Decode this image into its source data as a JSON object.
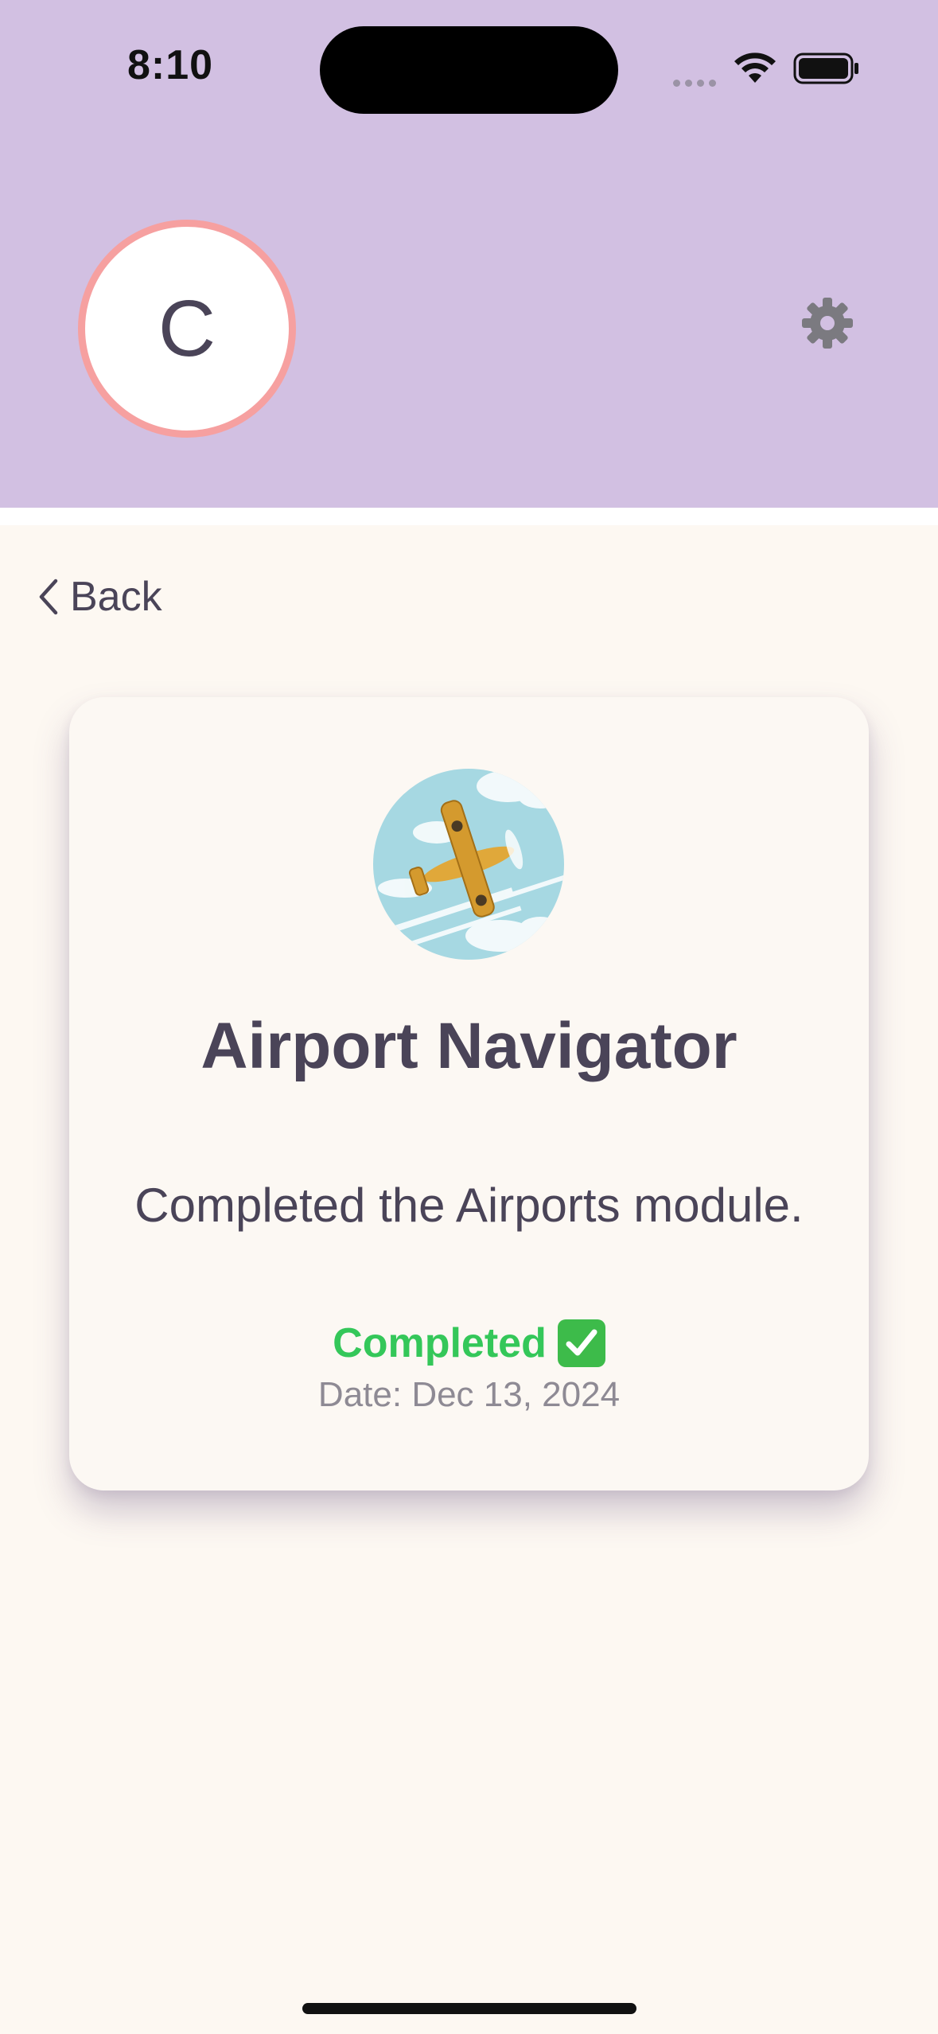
{
  "status_bar": {
    "time": "8:10"
  },
  "header": {
    "avatar_initial": "C",
    "settings_icon": "gear-icon",
    "background": "#d2c0e2",
    "avatar_border": "#f6a0a0"
  },
  "nav": {
    "back_label": "Back"
  },
  "achievement": {
    "icon": "airplane-badge-icon",
    "title": "Airport Navigator",
    "description": "Completed the Airports module.",
    "status": "Completed",
    "status_color": "#34c759",
    "date": "Date: Dec 13, 2024"
  }
}
